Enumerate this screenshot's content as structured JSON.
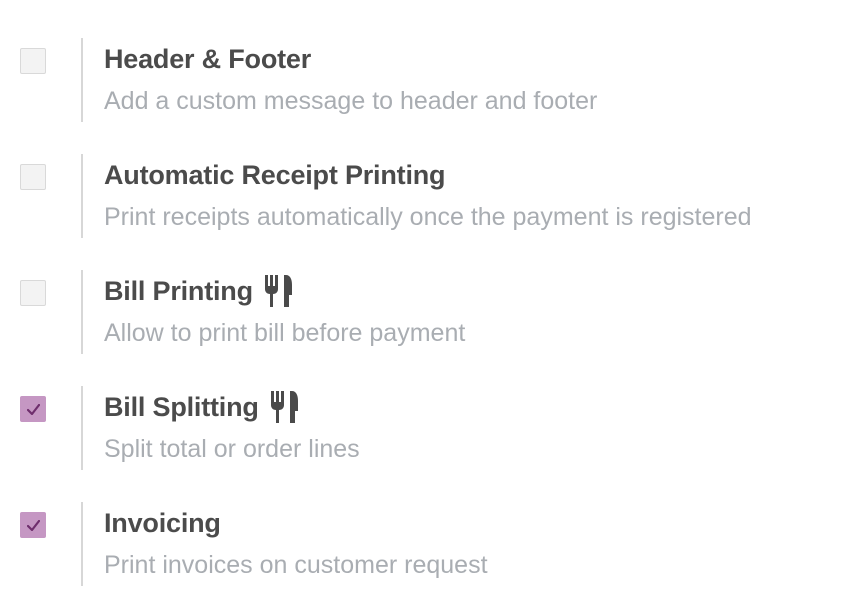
{
  "settings": [
    {
      "title": "Header & Footer",
      "description": "Add a custom message to header and footer",
      "checked": false,
      "restaurant_only": false
    },
    {
      "title": "Automatic Receipt Printing",
      "description": "Print receipts automatically once the payment is registered",
      "checked": false,
      "restaurant_only": false
    },
    {
      "title": "Bill Printing",
      "description": "Allow to print bill before payment",
      "checked": false,
      "restaurant_only": true
    },
    {
      "title": "Bill Splitting",
      "description": "Split total or order lines",
      "checked": true,
      "restaurant_only": true
    },
    {
      "title": "Invoicing",
      "description": "Print invoices on customer request",
      "checked": true,
      "restaurant_only": false
    }
  ],
  "icons": {
    "restaurant": "cutlery-icon",
    "check": "checkmark-icon"
  },
  "colors": {
    "checkbox_checked": "#c597c3",
    "checkmark": "#6f2e6d",
    "title": "#4b4b4b",
    "description": "#a9adb2",
    "divider": "#d7d7d7"
  }
}
